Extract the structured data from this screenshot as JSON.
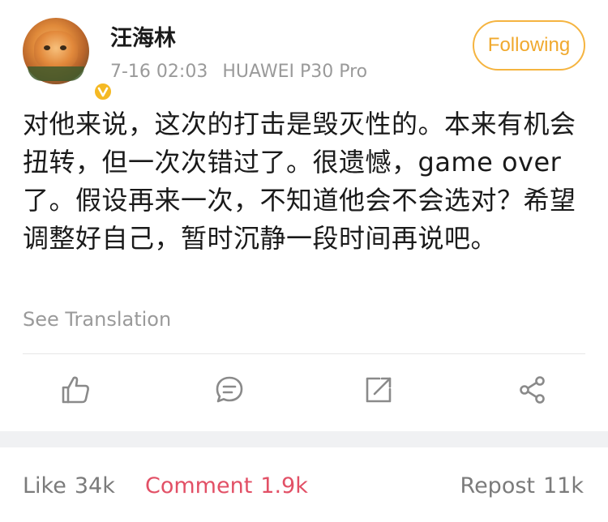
{
  "post": {
    "author": "汪海林",
    "timestamp": "7-16 02:03",
    "device": "HUAWEI P30 Pro",
    "verified_badge": "v",
    "follow_label": "Following",
    "content": "对他来说，这次的打击是毁灭性的。本来有机会扭转，但一次次错过了。很遗憾，game over了。假设再来一次，不知道他会不会选对？希望调整好自己，暂时沉静一段时间再说吧。",
    "see_translation": "See Translation"
  },
  "actions": [
    {
      "icon": "thumbs-up-icon"
    },
    {
      "icon": "comment-icon"
    },
    {
      "icon": "repost-icon"
    },
    {
      "icon": "share-icon"
    }
  ],
  "stats": {
    "like": {
      "label": "Like",
      "count": "34k"
    },
    "comment": {
      "label": "Comment",
      "count": "1.9k"
    },
    "repost": {
      "label": "Repost",
      "count": "11k"
    }
  },
  "colors": {
    "accent": "#f0a92e",
    "active_tab": "#e25066",
    "muted_text": "#9a9a9a",
    "verify_badge": "#f5b923"
  }
}
